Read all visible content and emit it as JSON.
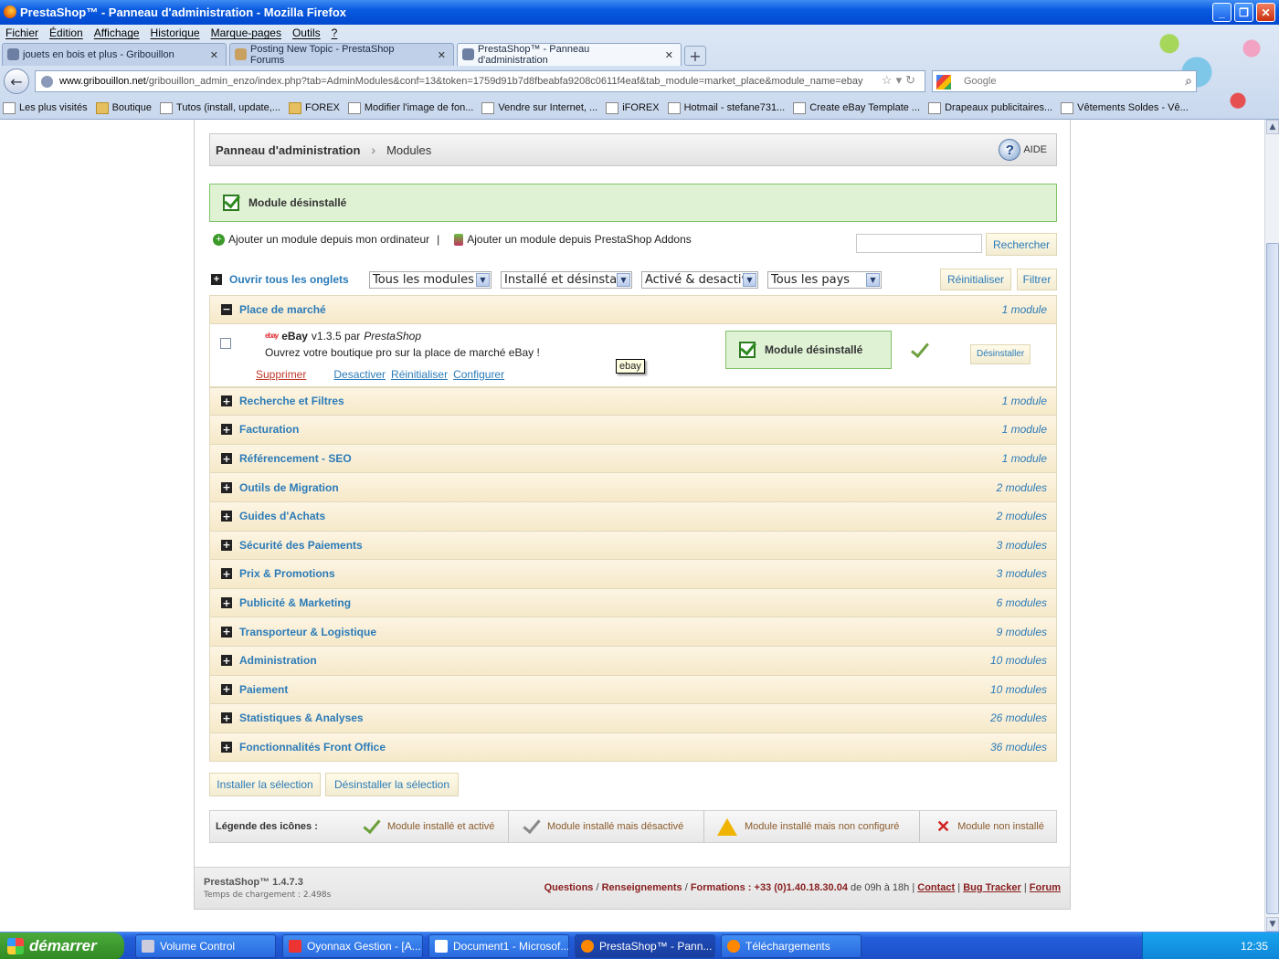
{
  "window": {
    "title": "PrestaShop™ - Panneau d'administration - Mozilla Firefox"
  },
  "menu": [
    "Fichier",
    "Édition",
    "Affichage",
    "Historique",
    "Marque-pages",
    "Outils",
    "?"
  ],
  "tabs": [
    {
      "label": "jouets en bois et plus - Gribouillon"
    },
    {
      "label": "Posting New Topic - PrestaShop Forums"
    },
    {
      "label": "PrestaShop™ - Panneau d'administration"
    }
  ],
  "url": {
    "domain": "www.gribouillon.net",
    "path": "/gribouillon_admin_enzo/index.php?tab=AdminModules&conf=13&token=1759d91b7d8fbeabfa9208c0611f4eaf&tab_module=market_place&module_name=ebay"
  },
  "search_engine": {
    "placeholder": "Google"
  },
  "bookmarks": [
    "Les plus visités",
    "Boutique",
    "Tutos (install, update,...",
    "FOREX",
    "Modifier l'image de fon...",
    "Vendre sur Internet, ...",
    "iFOREX",
    "Hotmail - stefane731...",
    "Create eBay Template ...",
    "Drapeaux publicitaires...",
    "Vêtements Soldes - Vê..."
  ],
  "breadcrumb": {
    "home": "Panneau d'administration",
    "current": "Modules",
    "help": "AIDE"
  },
  "confirmation": "Module désinstallé",
  "add_links": {
    "computer": "Ajouter un module depuis mon ordinateur",
    "separator": "|",
    "addons": "Ajouter un module depuis PrestaShop Addons"
  },
  "search": {
    "button": "Rechercher",
    "value": ""
  },
  "filters": {
    "open_all": "Ouvrir tous les onglets",
    "modules": "Tous les modules",
    "installed": "Installé et désinstallé",
    "enabled": "Activé & desactivé",
    "country": "Tous les pays",
    "reset": "Réinitialiser",
    "filter": "Filtrer"
  },
  "expanded_category": {
    "name": "Place de marché",
    "count": "1 module",
    "module": {
      "logo": "ebay",
      "name": "eBay",
      "version": "v1.3.5 par",
      "author": "PrestaShop",
      "description": "Ouvrez votre boutique pro sur la place de marché eBay !",
      "link_delete": "Supprimer",
      "link_disable": "Desactiver",
      "link_reset": "Réinitialiser",
      "link_configure": "Configurer",
      "tooltip": "ebay",
      "status_message": "Module désinstallé",
      "uninstall": "Désinstaller"
    }
  },
  "categories": [
    {
      "name": "Recherche et Filtres",
      "count": "1 module"
    },
    {
      "name": "Facturation",
      "count": "1 module"
    },
    {
      "name": "Référencement - SEO",
      "count": "1 module"
    },
    {
      "name": "Outils de Migration",
      "count": "2 modules"
    },
    {
      "name": "Guides d'Achats",
      "count": "2 modules"
    },
    {
      "name": "Sécurité des Paiements",
      "count": "3 modules"
    },
    {
      "name": "Prix & Promotions",
      "count": "3 modules"
    },
    {
      "name": "Publicité & Marketing",
      "count": "6 modules"
    },
    {
      "name": "Transporteur & Logistique",
      "count": "9 modules"
    },
    {
      "name": "Administration",
      "count": "10 modules"
    },
    {
      "name": "Paiement",
      "count": "10 modules"
    },
    {
      "name": "Statistiques & Analyses",
      "count": "26 modules"
    },
    {
      "name": "Fonctionnalités Front Office",
      "count": "36 modules"
    }
  ],
  "bulk": {
    "install": "Installer la sélection",
    "uninstall": "Désinstaller la sélection"
  },
  "legend": {
    "title": "Légende des icônes :",
    "active": "Module installé et activé",
    "disabled": "Module installé mais désactivé",
    "unconfigured": "Module installé mais non configuré",
    "not_installed": "Module non installé"
  },
  "footer": {
    "version": "PrestaShop™ 1.4.7.3",
    "load_time": "Temps de chargement : 2.498s",
    "questions": "Questions",
    "info": "Renseignements",
    "training": "Formations :",
    "phone": "+33 (0)1.40.18.30.04",
    "hours": "de 09h à 18h",
    "contact": "Contact",
    "bugtracker": "Bug Tracker",
    "forum": "Forum"
  },
  "taskbar": {
    "start": "démarrer",
    "items": [
      "Volume Control",
      "Oyonnax Gestion - [A...",
      "Document1 - Microsof...",
      "PrestaShop™ - Pann...",
      "Téléchargements"
    ],
    "clock": "12:35"
  }
}
